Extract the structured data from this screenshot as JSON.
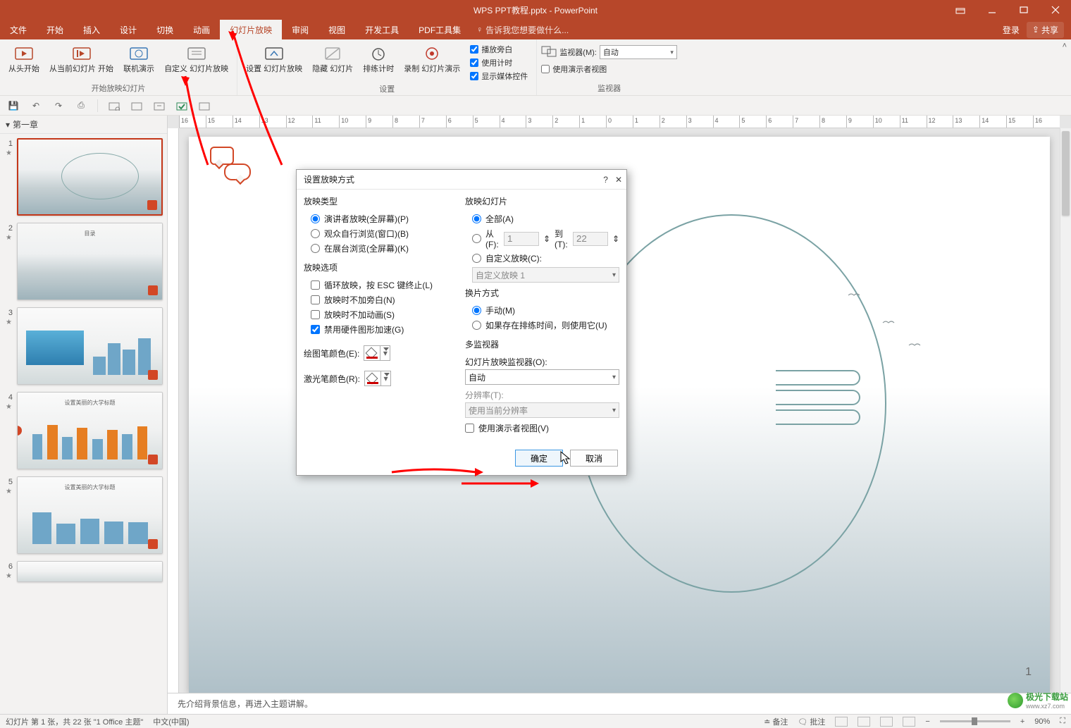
{
  "titlebar": {
    "title": "WPS PPT教程.pptx - PowerPoint"
  },
  "menubar": {
    "tabs": [
      "文件",
      "开始",
      "插入",
      "设计",
      "切换",
      "动画",
      "幻灯片放映",
      "审阅",
      "视图",
      "开发工具",
      "PDF工具集"
    ],
    "active_index": 6,
    "hint": "告诉我您想要做什么...",
    "login": "登录",
    "share": "共享"
  },
  "ribbon": {
    "groups": {
      "start": {
        "label": "开始放映幻灯片",
        "items": [
          "从头开始",
          "从当前幻灯片\n开始",
          "联机演示",
          "自定义\n幻灯片放映"
        ]
      },
      "setup": {
        "label": "设置",
        "items": [
          "设置\n幻灯片放映",
          "隐藏\n幻灯片",
          "排练计时",
          "录制\n幻灯片演示"
        ],
        "checks": [
          "播放旁白",
          "使用计时",
          "显示媒体控件"
        ]
      },
      "monitor": {
        "label": "监视器",
        "monitor_label": "监视器(M):",
        "monitor_value": "自动",
        "presenter_view": "使用演示者视图"
      }
    }
  },
  "outline": {
    "section": "第一章"
  },
  "dialog": {
    "title": "设置放映方式",
    "left": {
      "type_legend": "放映类型",
      "type_options": [
        "演讲者放映(全屏幕)(P)",
        "观众自行浏览(窗口)(B)",
        "在展台浏览(全屏幕)(K)"
      ],
      "opts_legend": "放映选项",
      "opts": [
        "循环放映，按 ESC 键终止(L)",
        "放映时不加旁白(N)",
        "放映时不加动画(S)",
        "禁用硬件图形加速(G)"
      ],
      "pen_label": "绘图笔颜色(E):",
      "laser_label": "激光笔颜色(R):"
    },
    "right": {
      "slides_legend": "放映幻灯片",
      "all": "全部(A)",
      "from": "从(F):",
      "from_v": "1",
      "to": "到(T):",
      "to_v": "22",
      "custom": "自定义放映(C):",
      "custom_val": "自定义放映 1",
      "advance_legend": "换片方式",
      "manual": "手动(M)",
      "timed": "如果存在排练时间，则使用它(U)",
      "multi_legend": "多监视器",
      "monitor_label": "幻灯片放映监视器(O):",
      "monitor_val": "自动",
      "res_label": "分辨率(T):",
      "res_val": "使用当前分辨率",
      "presenter": "使用演示者视图(V)"
    },
    "ok": "确定",
    "cancel": "取消"
  },
  "notes": "先介绍背景信息，再进入主题讲解。",
  "status": {
    "left": "幻灯片 第 1 张，共 22 张     \"1  Office 主题\"",
    "lang": "中文(中国)",
    "notes_btn": "备注",
    "comments_btn": "批注",
    "zoom": "90%"
  },
  "slide": {
    "page_num": "1"
  },
  "ruler": [
    "16",
    "15",
    "14",
    "13",
    "12",
    "11",
    "10",
    "9",
    "8",
    "7",
    "6",
    "5",
    "4",
    "3",
    "2",
    "1",
    "0",
    "1",
    "2",
    "3",
    "4",
    "5",
    "6",
    "7",
    "8",
    "9",
    "10",
    "11",
    "12",
    "13",
    "14",
    "15",
    "16"
  ],
  "watermark": {
    "line1": "极光下载站",
    "line2": "www.xz7.com"
  }
}
